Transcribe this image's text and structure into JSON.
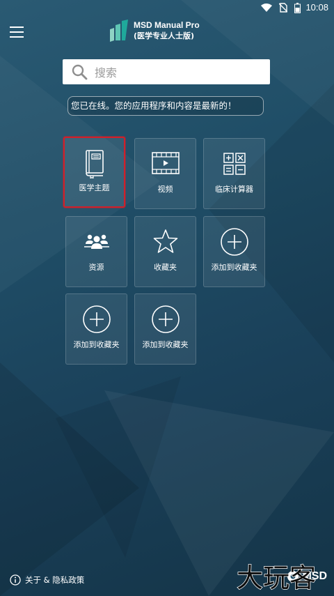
{
  "status_bar": {
    "time": "10:08",
    "icons": [
      "wifi-icon",
      "no-sim-icon",
      "battery-icon"
    ]
  },
  "header": {
    "menu_icon": "hamburger-icon",
    "logo_title": "MSD Manual Pro",
    "logo_subtitle": "(医学专业人士版)",
    "logo_colors": [
      "#1fa99b",
      "#5fc6b4",
      "#8fd3c4"
    ]
  },
  "search": {
    "placeholder": "搜索"
  },
  "status_message": "您已在线。您的应用程序和内容是最新的！",
  "tiles": [
    {
      "label": "医学主题",
      "icon": "book-icon",
      "selected": true
    },
    {
      "label": "视频",
      "icon": "film-icon",
      "selected": false
    },
    {
      "label": "临床计算器",
      "icon": "calculator-icon",
      "selected": false
    },
    {
      "label": "资源",
      "icon": "people-icon",
      "selected": false
    },
    {
      "label": "收藏夹",
      "icon": "star-icon",
      "selected": false
    },
    {
      "label": "添加到收藏夹",
      "icon": "plus-circle-icon",
      "selected": false
    },
    {
      "label": "添加到收藏夹",
      "icon": "plus-circle-icon",
      "selected": false
    },
    {
      "label": "添加到收藏夹",
      "icon": "plus-circle-icon",
      "selected": false
    }
  ],
  "footer": {
    "about_label": "关于 & 隐私政策",
    "brand": "MSD"
  },
  "watermark_text": "大玩客",
  "colors": {
    "selected_border": "#d0202a",
    "background": "#1f4d66"
  }
}
